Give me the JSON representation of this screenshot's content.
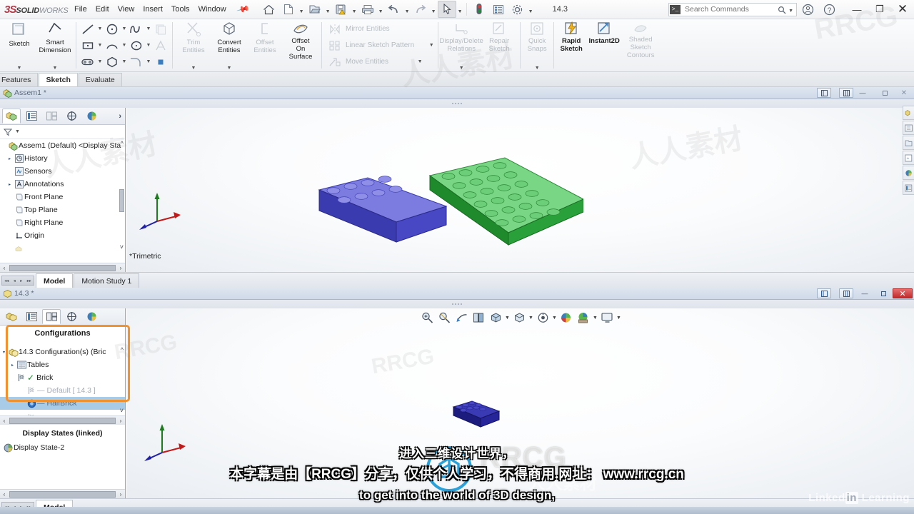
{
  "app": {
    "logo_mark": "3S",
    "logo_bold": "SOLID",
    "logo_light": "WORKS",
    "version_label": "14.3"
  },
  "menubar": {
    "items": [
      {
        "label": "File"
      },
      {
        "label": "Edit"
      },
      {
        "label": "View"
      },
      {
        "label": "Insert"
      },
      {
        "label": "Tools"
      },
      {
        "label": "Window"
      }
    ],
    "pin_icon": "pushpin-icon"
  },
  "quick_access": {
    "buttons": [
      {
        "name": "home-icon",
        "label": "Home"
      },
      {
        "name": "new-document-icon",
        "label": "New"
      },
      {
        "name": "open-folder-icon",
        "label": "Open"
      },
      {
        "name": "save-warning-icon",
        "label": "Save"
      },
      {
        "name": "print-icon",
        "label": "Print"
      },
      {
        "name": "undo-icon",
        "label": "Undo"
      },
      {
        "name": "redo-icon",
        "label": "Redo"
      },
      {
        "name": "select-cursor-icon",
        "label": "Select"
      },
      {
        "name": "rebuild-traffic-light-icon",
        "label": "Rebuild"
      },
      {
        "name": "options-list-icon",
        "label": "Options"
      },
      {
        "name": "gear-icon",
        "label": "Settings"
      }
    ]
  },
  "search": {
    "placeholder": "Search Commands",
    "prompt_glyph": ">_",
    "magnifier": "search-icon"
  },
  "window_controls": {
    "minimize": "—",
    "maximize": "❐",
    "close": "✕"
  },
  "ribbon": {
    "groups": [
      {
        "name": "sketch-group",
        "big_buttons": [
          {
            "label": "Sketch",
            "icon": "sketch-icon",
            "dim": false,
            "dropdown": true
          },
          {
            "label": "Smart\nDimension",
            "icon": "smart-dimension-icon",
            "dim": false,
            "dropdown": true
          }
        ]
      },
      {
        "name": "entities-group",
        "icon_rows": [
          [
            "line-icon",
            "circle-icon",
            "spline-icon",
            "dim-sketch-block-icon"
          ],
          [
            "rectangle-icon",
            "arc-icon",
            "ellipse-icon",
            "dim-parabola-icon"
          ],
          [
            "slot-icon",
            "polygon-icon",
            "fillet-icon",
            "point-icon"
          ]
        ]
      },
      {
        "name": "tools-group",
        "big_buttons": [
          {
            "label": "Trim\nEntities",
            "icon": "trim-entities-icon",
            "dim": true,
            "dropdown": true
          },
          {
            "label": "Convert\nEntities",
            "icon": "convert-entities-icon",
            "dim": false,
            "dropdown": true
          },
          {
            "label": "Offset\nEntities",
            "icon": "offset-entities-icon",
            "dim": true,
            "dropdown": false
          },
          {
            "label": "Offset\nOn\nSurface",
            "icon": "offset-on-surface-icon",
            "dim": false,
            "dropdown": false
          }
        ]
      },
      {
        "name": "pattern-group",
        "text_rows": [
          {
            "label": "Mirror Entities",
            "icon": "mirror-entities-icon",
            "dim": true,
            "dropdown": false
          },
          {
            "label": "Linear Sketch Pattern",
            "icon": "linear-sketch-pattern-icon",
            "dim": true,
            "dropdown": true
          },
          {
            "label": "Move Entities",
            "icon": "move-entities-icon",
            "dim": true,
            "dropdown": true
          }
        ]
      },
      {
        "name": "relations-group",
        "big_buttons": [
          {
            "label": "Display/Delete\nRelations",
            "icon": "display-delete-relations-icon",
            "dim": true,
            "dropdown": true
          },
          {
            "label": "Repair\nSketch",
            "icon": "repair-sketch-icon",
            "dim": true,
            "dropdown": false
          }
        ]
      },
      {
        "name": "snaps-group",
        "big_buttons": [
          {
            "label": "Quick\nSnaps",
            "icon": "quick-snaps-icon",
            "dim": true,
            "dropdown": true
          }
        ]
      },
      {
        "name": "rapid-group",
        "big_buttons": [
          {
            "label": "Rapid\nSketch",
            "icon": "rapid-sketch-icon",
            "dim": false,
            "dropdown": false
          },
          {
            "label": "Instant2D",
            "icon": "instant2d-icon",
            "dim": false,
            "dropdown": false
          },
          {
            "label": "Shaded\nSketch\nContours",
            "icon": "shaded-sketch-contours-icon",
            "dim": true,
            "dropdown": false
          }
        ]
      }
    ]
  },
  "command_tabs": [
    {
      "label": "Features",
      "active": false
    },
    {
      "label": "Sketch",
      "active": true
    },
    {
      "label": "Evaluate",
      "active": false
    }
  ],
  "documents": [
    {
      "name": "assembly-window",
      "title": "Assem1 *",
      "title_icon": "assembly-icon",
      "window_buttons": [
        {
          "name": "tile-horizontal-button",
          "glyph": "⧉"
        },
        {
          "name": "tile-vertical-button",
          "glyph": "⧉"
        },
        {
          "name": "minimize-button",
          "glyph": "—"
        },
        {
          "name": "restore-button",
          "glyph": "▫"
        },
        {
          "name": "close-button",
          "glyph": "✕",
          "red": false
        }
      ],
      "feature_manager": {
        "tabs": [
          {
            "name": "feature-tree-tab",
            "icon": "feature-tree-icon",
            "active": true
          },
          {
            "name": "property-manager-tab",
            "icon": "property-manager-icon",
            "active": false
          },
          {
            "name": "configuration-manager-tab",
            "icon": "configuration-manager-icon",
            "active": false
          },
          {
            "name": "dimxpert-manager-tab",
            "icon": "dimxpert-icon",
            "active": false
          },
          {
            "name": "display-manager-tab",
            "icon": "display-manager-icon",
            "active": false
          }
        ],
        "filter_icon": "filter-icon",
        "tree": [
          {
            "label": "Assem1 (Default) <Display Sta",
            "icon": "assembly-icon",
            "indent": 0,
            "expander": "",
            "selected": false
          },
          {
            "label": "History",
            "icon": "history-icon",
            "indent": 1,
            "expander": "▸",
            "selected": false
          },
          {
            "label": "Sensors",
            "icon": "sensors-icon",
            "indent": 1,
            "expander": "",
            "selected": false
          },
          {
            "label": "Annotations",
            "icon": "annotations-icon",
            "indent": 1,
            "expander": "▸",
            "selected": false
          },
          {
            "label": "Front Plane",
            "icon": "plane-icon",
            "indent": 1,
            "expander": "",
            "selected": false
          },
          {
            "label": "Top Plane",
            "icon": "plane-icon",
            "indent": 1,
            "expander": "",
            "selected": false
          },
          {
            "label": "Right Plane",
            "icon": "plane-icon",
            "indent": 1,
            "expander": "",
            "selected": false
          },
          {
            "label": "Origin",
            "icon": "origin-icon",
            "indent": 1,
            "expander": "",
            "selected": false
          }
        ]
      },
      "viewport": {
        "view_label": "*Trimetric",
        "triad": "coordinate-triad-icon",
        "models": [
          {
            "name": "blue-brick-model",
            "color": "#5b5bc8",
            "top_color": "#7b7bdc",
            "studs": 8
          },
          {
            "name": "green-plate-model",
            "color": "#2f9d3a",
            "top_color": "#7ada86",
            "studs": 32
          }
        ]
      },
      "bottom_tabs": [
        {
          "label": "Model",
          "active": true
        },
        {
          "label": "Motion Study 1",
          "active": false
        }
      ]
    },
    {
      "name": "part-window",
      "title": "14.3 *",
      "title_icon": "part-icon",
      "window_buttons": [
        {
          "name": "tile-horizontal-button",
          "glyph": "⧉"
        },
        {
          "name": "tile-vertical-button",
          "glyph": "⧉"
        },
        {
          "name": "minimize-button",
          "glyph": "—"
        },
        {
          "name": "restore-button",
          "glyph": "▫"
        },
        {
          "name": "close-button",
          "glyph": "✕",
          "red": true
        }
      ],
      "feature_manager": {
        "tabs": [
          {
            "name": "feature-tree-tab",
            "icon": "feature-tree-icon",
            "active": false
          },
          {
            "name": "property-manager-tab",
            "icon": "property-manager-icon",
            "active": false
          },
          {
            "name": "configuration-manager-tab",
            "icon": "configuration-manager-icon",
            "active": true
          },
          {
            "name": "dimxpert-manager-tab",
            "icon": "dimxpert-icon",
            "active": false
          },
          {
            "name": "display-manager-tab",
            "icon": "display-manager-icon",
            "active": false
          }
        ],
        "configurations_header": "Configurations",
        "tree": [
          {
            "label": "14.3 Configuration(s)  (Bric",
            "icon": "part-config-icon",
            "indent": 0,
            "expander": "▾",
            "selected": false,
            "dim": false
          },
          {
            "label": "Tables",
            "icon": "tables-folder-icon",
            "indent": 1,
            "expander": "▸",
            "selected": false,
            "dim": false
          },
          {
            "label": "Brick",
            "icon": "config-flag-icon",
            "indent": 1,
            "expander": "",
            "selected": false,
            "dim": false,
            "check": true
          },
          {
            "label": "Default [ 14.3 ]",
            "icon": "config-flag-icon",
            "indent": 2,
            "expander": "",
            "selected": false,
            "dim": true,
            "dash": true
          },
          {
            "label": "HalfBrick",
            "icon": "config-active-icon",
            "indent": 2,
            "expander": "",
            "selected": true,
            "dim": true,
            "dash": true
          }
        ],
        "display_states_header": "Display States (linked)",
        "display_states": [
          {
            "label": "Display State-2",
            "icon": "display-state-icon"
          }
        ]
      },
      "viewport": {
        "toolbar": [
          {
            "name": "zoom-to-fit-icon",
            "dropdown": false
          },
          {
            "name": "zoom-to-area-icon",
            "dropdown": false
          },
          {
            "name": "previous-view-icon",
            "dropdown": false
          },
          {
            "name": "section-view-icon",
            "dropdown": false
          },
          {
            "name": "view-orientation-icon",
            "dropdown": true
          },
          {
            "name": "display-style-icon",
            "dropdown": true
          },
          {
            "name": "hide-show-items-icon",
            "dropdown": true
          },
          {
            "name": "edit-appearance-icon",
            "dropdown": false
          },
          {
            "name": "apply-scene-icon",
            "dropdown": true
          },
          {
            "name": "view-settings-icon",
            "dropdown": true
          }
        ],
        "triad": "coordinate-triad-icon",
        "models": [
          {
            "name": "blue-brick-model",
            "color": "#2b2b96",
            "top_color": "#3a3ab0",
            "studs": 8
          }
        ]
      },
      "bottom_tabs": [
        {
          "label": "Model",
          "active": true
        }
      ]
    }
  ],
  "task_pane": {
    "icons": [
      {
        "name": "solidworks-resources-icon"
      },
      {
        "name": "design-library-icon"
      },
      {
        "name": "file-explorer-icon"
      },
      {
        "name": "view-palette-icon"
      },
      {
        "name": "appearances-scenes-icon"
      },
      {
        "name": "custom-properties-icon"
      }
    ]
  },
  "subtitles": {
    "chinese_top": "进入三维设计世界，",
    "main_line": "本字幕是由【RRCG】分享，仅供个人学习，不得商用.网址： www.rrcg.cn",
    "english_line": "to get into the world of 3D design,"
  },
  "watermarks": {
    "rrcg_word": "RRCG",
    "rr_chinese": "人人素材",
    "linkedin_prefix": "Linked",
    "linkedin_in": "in",
    "linkedin_suffix": "Learning",
    "scatter": [
      "人人素材",
      "人人素材",
      "人人素材",
      "RRCG",
      "RRCG"
    ]
  },
  "colors": {
    "accent_orange": "#f0922f",
    "selection_blue": "#a8cbe8",
    "brick_blue": "#5b5bc8",
    "plate_green": "#5fc96e",
    "close_red": "#c22b2b"
  }
}
